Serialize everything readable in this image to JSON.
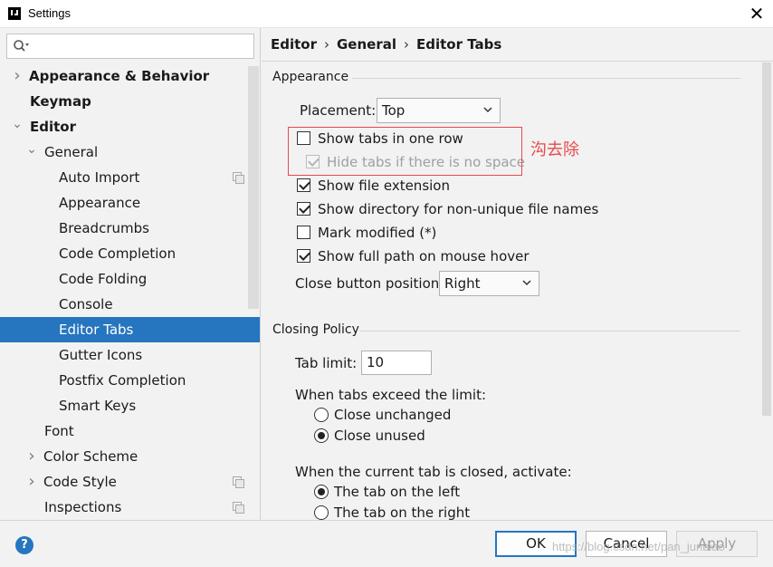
{
  "window": {
    "title": "Settings",
    "close_glyph": "✕"
  },
  "sidebar": {
    "search_value": "",
    "items": [
      {
        "label": "Appearance & Behavior",
        "arrow": "›"
      },
      {
        "label": "Keymap"
      },
      {
        "label": "Editor",
        "arrow": "⌄"
      },
      {
        "label": "General",
        "arrow": "⌄"
      },
      {
        "label": "Auto Import"
      },
      {
        "label": "Appearance"
      },
      {
        "label": "Breadcrumbs"
      },
      {
        "label": "Code Completion"
      },
      {
        "label": "Code Folding"
      },
      {
        "label": "Console"
      },
      {
        "label": "Editor Tabs",
        "selected": true
      },
      {
        "label": "Gutter Icons"
      },
      {
        "label": "Postfix Completion"
      },
      {
        "label": "Smart Keys"
      },
      {
        "label": "Font"
      },
      {
        "label": "Color Scheme",
        "arrow": "›"
      },
      {
        "label": "Code Style",
        "arrow": "›"
      },
      {
        "label": "Inspections"
      }
    ]
  },
  "breadcrumb": [
    "Editor",
    "General",
    "Editor Tabs"
  ],
  "appearance": {
    "title": "Appearance",
    "placement_label": "Placement:",
    "placement_value": "Top",
    "show_tabs_one_row": {
      "label": "Show tabs in one row",
      "checked": false
    },
    "hide_tabs_no_space": {
      "label": "Hide tabs if there is no space",
      "checked": true,
      "disabled": true
    },
    "show_file_extension": {
      "label": "Show file extension",
      "checked": true
    },
    "show_directory": {
      "label": "Show directory for non-unique file names",
      "checked": true
    },
    "mark_modified": {
      "label": "Mark modified (*)",
      "checked": false
    },
    "show_full_path": {
      "label": "Show full path on mouse hover",
      "checked": true
    },
    "close_button_label": "Close button position:",
    "close_button_value": "Right"
  },
  "annotation": {
    "text": "沟去除",
    "color": "#e84a4a"
  },
  "closing_policy": {
    "title": "Closing Policy",
    "tab_limit_label": "Tab limit:",
    "tab_limit_value": "10",
    "exceed_label": "When tabs exceed the limit:",
    "exceed_options": [
      {
        "label": "Close unchanged",
        "selected": false
      },
      {
        "label": "Close unused",
        "selected": true
      }
    ],
    "closed_label": "When the current tab is closed, activate:",
    "closed_options": [
      {
        "label": "The tab on the left",
        "selected": true
      },
      {
        "label": "The tab on the right",
        "selected": false
      }
    ]
  },
  "buttons": {
    "help": "?",
    "ok": "OK",
    "cancel": "Cancel",
    "apply": "Apply"
  },
  "watermark": "https://blog.csdn.net/pan_junbiao",
  "colors": {
    "accent": "#2675bf",
    "annotation": "#e84a4a"
  }
}
